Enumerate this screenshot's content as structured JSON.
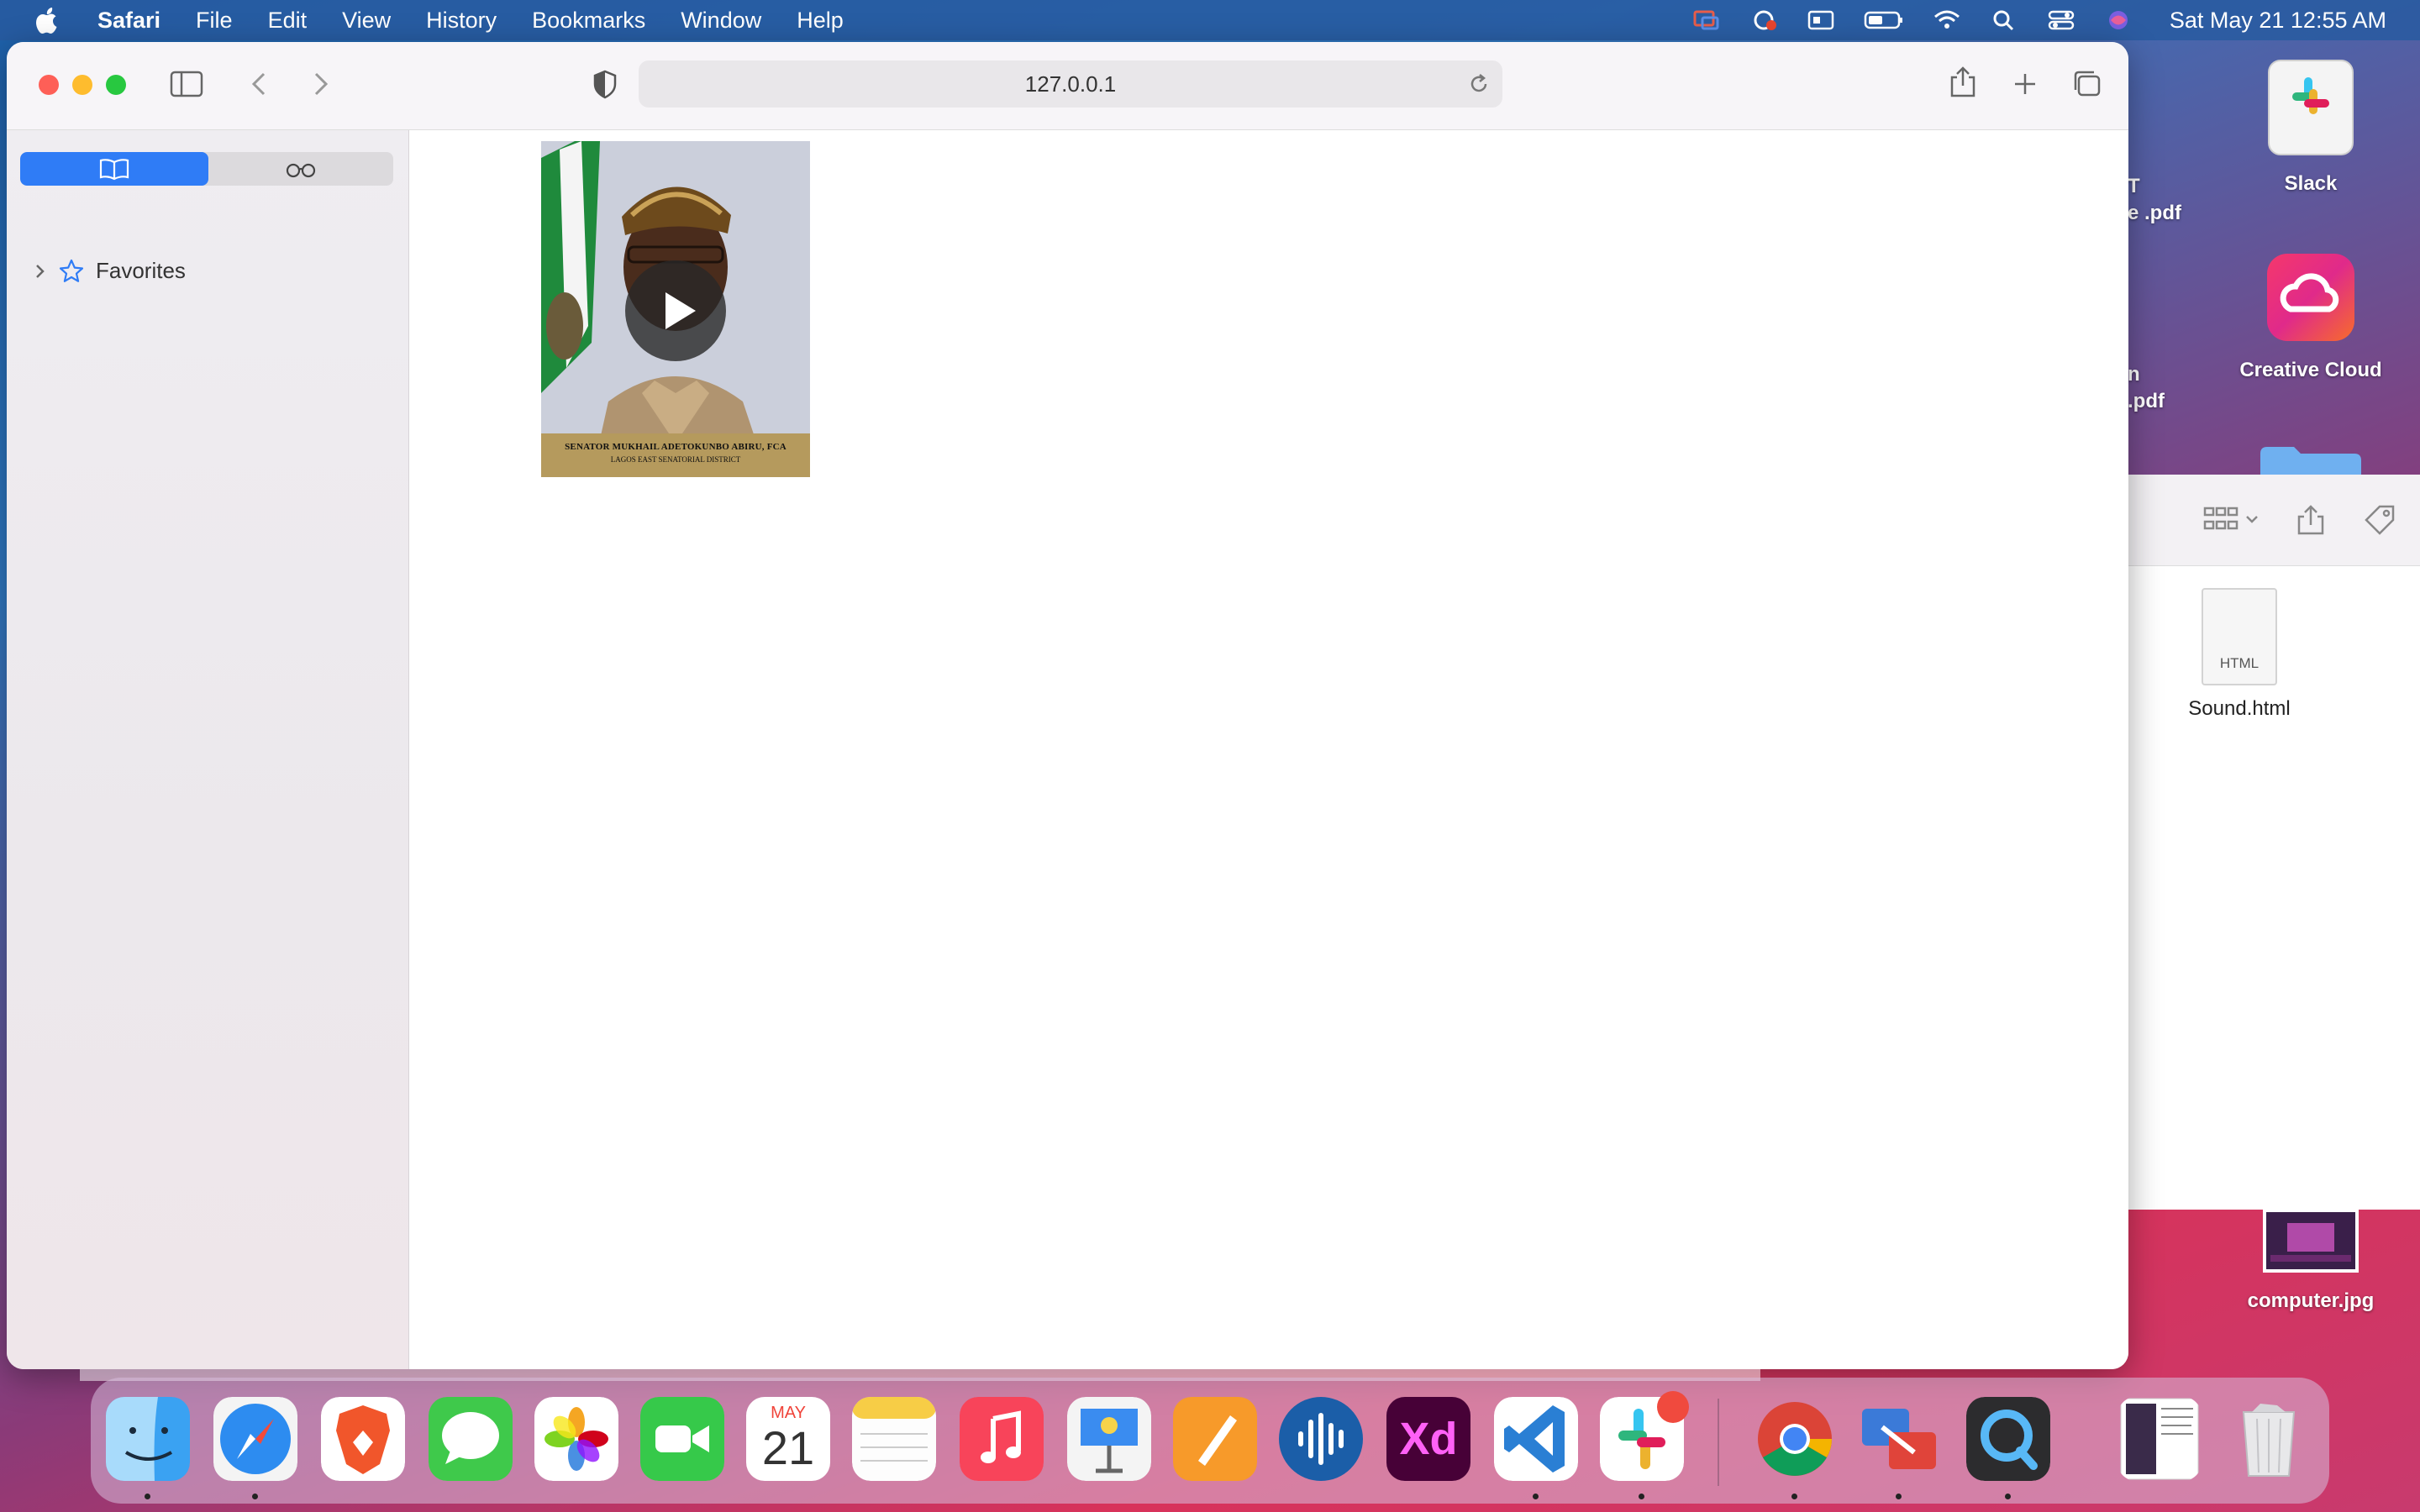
{
  "menubar": {
    "app_name": "Safari",
    "items": [
      "File",
      "Edit",
      "View",
      "History",
      "Bookmarks",
      "Window",
      "Help"
    ],
    "clock": "Sat May 21  12:55 AM"
  },
  "browser": {
    "url": "127.0.0.1",
    "sidebar": {
      "favorites_label": "Favorites"
    },
    "video": {
      "caption_line1": "SENATOR MUKHAIL ADETOKUNBO ABIRU, FCA",
      "caption_line2": "LAGOS EAST SENATORIAL DISTRICT"
    }
  },
  "desktop": {
    "items": [
      {
        "label": "Slack"
      },
      {
        "label": "Creative Cloud"
      },
      {
        "label": "computer.jpg"
      }
    ],
    "partial_labels": [
      "T",
      "e .pdf",
      "n",
      ".pdf"
    ],
    "finder_file": {
      "name": "Sound.html",
      "type_label": "HTML"
    }
  },
  "dock": {
    "calendar_month": "MAY",
    "calendar_day": "21",
    "apps": [
      "Finder",
      "Safari",
      "Brave",
      "Messages",
      "Photos",
      "FaceTime",
      "Calendar",
      "Notes",
      "Music",
      "Keynote",
      "Pages",
      "SoundSource",
      "Adobe XD",
      "Visual Studio Code",
      "Slack",
      "Chrome",
      "Screens",
      "QuickTime Player",
      "Downloads",
      "Trash"
    ],
    "xd_label": "Xd"
  },
  "colors": {
    "accent": "#2f7cf6",
    "close": "#fe5f57",
    "minimize": "#febc2e",
    "zoom": "#28c840"
  }
}
